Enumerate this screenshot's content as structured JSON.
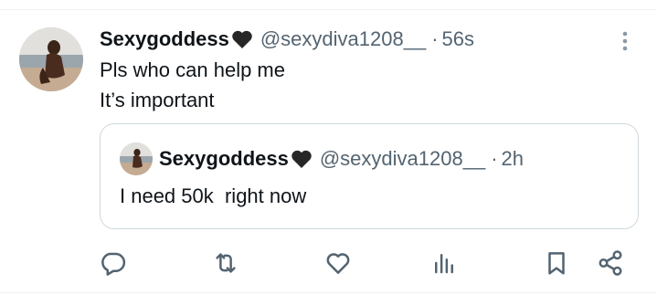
{
  "post": {
    "display_name": "Sexygoddess",
    "handle": "@sexydiva1208__",
    "separator": "·",
    "time": "56s",
    "text_lines": [
      "Pls who can help me",
      "It’s important"
    ]
  },
  "quoted_post": {
    "display_name": "Sexygoddess",
    "handle": "@sexydiva1208__",
    "separator": "·",
    "time": "2h",
    "text": "I need 50k  right now"
  },
  "icons": {
    "name_emoji": "black-heart-icon",
    "more": "more-vertical-icon",
    "reply": "reply-icon",
    "repost": "repost-icon",
    "like": "like-icon",
    "views": "views-icon",
    "bookmark": "bookmark-icon",
    "share": "share-icon"
  },
  "colors": {
    "text_primary": "#0f1419",
    "text_secondary": "#536471",
    "border": "#cfd9de",
    "divider": "#eff3f4"
  }
}
